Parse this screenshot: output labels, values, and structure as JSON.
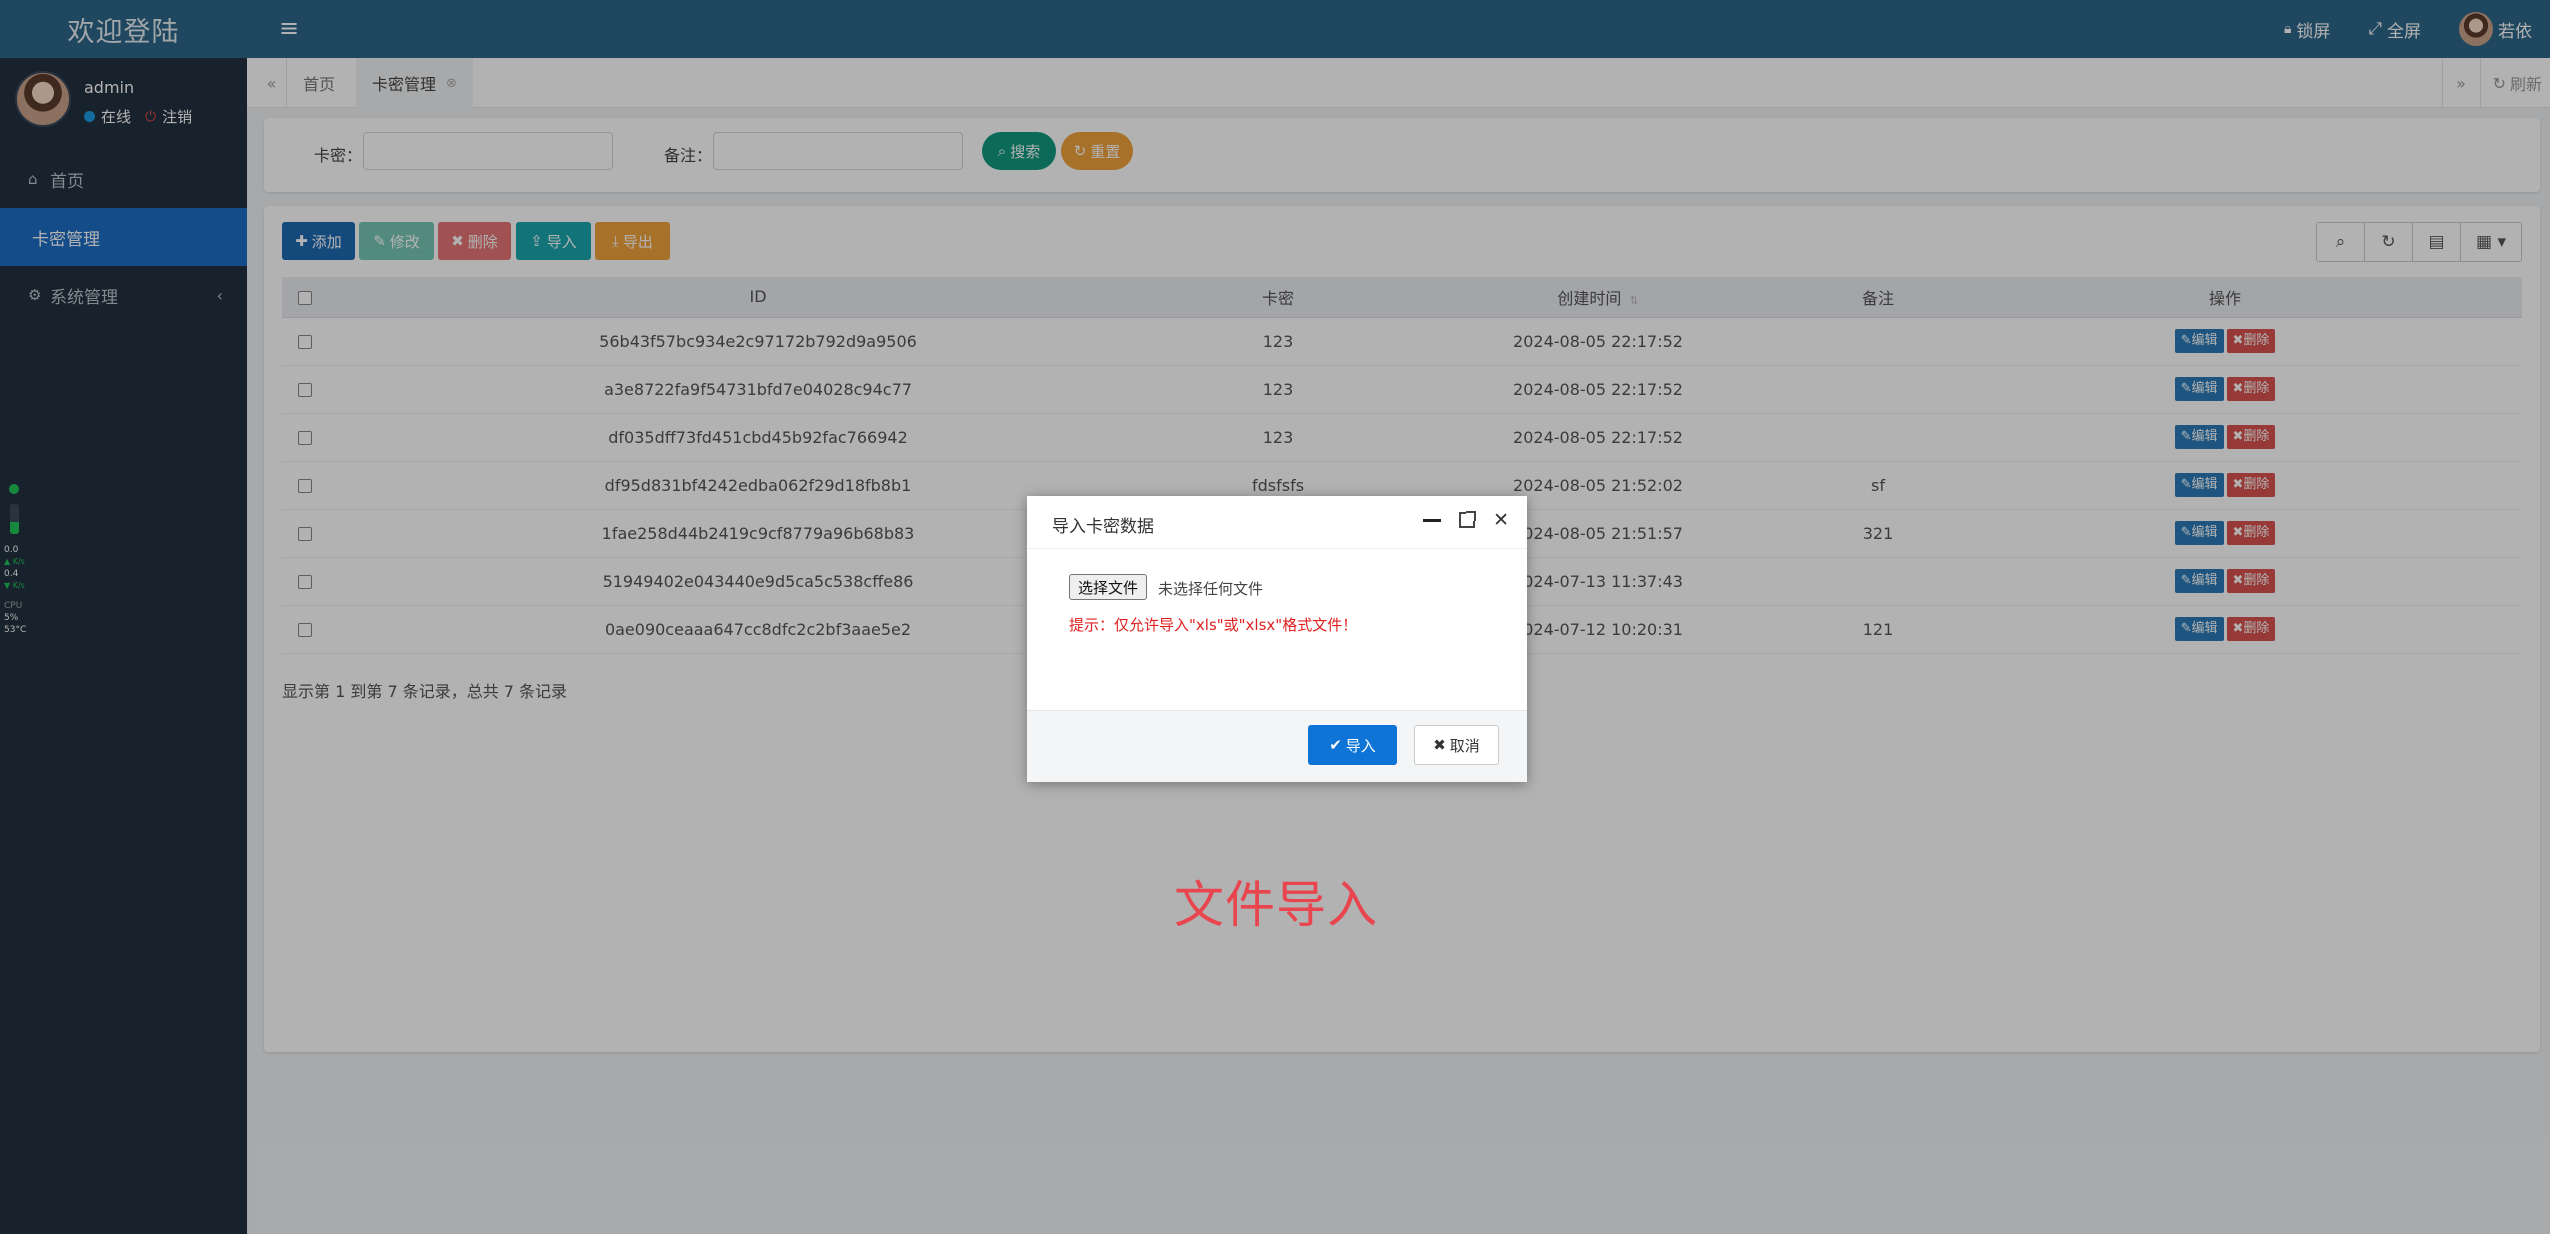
{
  "app": {
    "brand": "欢迎登陆",
    "user": {
      "name": "admin",
      "online": "在线",
      "logout": "注销"
    },
    "menu": [
      {
        "icon": "home-icon",
        "label": "首页"
      },
      {
        "icon": "",
        "label": "卡密管理"
      },
      {
        "icon": "gear-icon",
        "label": "系统管理"
      }
    ],
    "monitor": {
      "up": "0.0",
      "up_unit": "K/s",
      "down": "0.4",
      "down_unit": "K/s",
      "cpu_label": "CPU",
      "cpu": "5",
      "cpu_unit": "%",
      "temp": "53",
      "temp_unit": "°C"
    }
  },
  "topbar": {
    "lock": "锁屏",
    "fullscreen": "全屏",
    "username": "若依"
  },
  "tabs": {
    "home": "首页",
    "current": "卡密管理",
    "refresh": "刷新"
  },
  "search": {
    "card_label": "卡密：",
    "remark_label": "备注：",
    "search_btn": "搜索",
    "reset_btn": "重置"
  },
  "toolbar": {
    "add": "添加",
    "edit": "修改",
    "delete": "删除",
    "import": "导入",
    "export": "导出"
  },
  "table": {
    "headers": {
      "id": "ID",
      "card": "卡密",
      "created": "创建时间",
      "remark": "备注",
      "ops": "操作"
    },
    "op_edit": "编辑",
    "op_delete": "删除",
    "rows": [
      {
        "id": "56b43f57bc934e2c97172b792d9a9506",
        "card": "123",
        "created": "2024-08-05 22:17:52",
        "remark": ""
      },
      {
        "id": "a3e8722fa9f54731bfd7e04028c94c77",
        "card": "123",
        "created": "2024-08-05 22:17:52",
        "remark": ""
      },
      {
        "id": "df035dff73fd451cbd45b92fac766942",
        "card": "123",
        "created": "2024-08-05 22:17:52",
        "remark": ""
      },
      {
        "id": "df95d831bf4242edba062f29d18fb8b1",
        "card": "fdsfsfs",
        "created": "2024-08-05 21:52:02",
        "remark": "sf"
      },
      {
        "id": "1fae258d44b2419c9cf8779a96b68b83",
        "card": "",
        "created": "2024-08-05 21:51:57",
        "remark": "321"
      },
      {
        "id": "51949402e043440e9d5ca5c538cffe86",
        "card": "",
        "created": "2024-07-13 11:37:43",
        "remark": ""
      },
      {
        "id": "0ae090ceaaa647cc8dfc2c2bf3aae5e2",
        "card": "",
        "created": "2024-07-12 10:20:31",
        "remark": "121"
      }
    ],
    "pager_info": "显示第 1 到第 7 条记录，总共 7 条记录"
  },
  "modal": {
    "title": "导入卡密数据",
    "choose_file": "选择文件",
    "no_file": "未选择任何文件",
    "tip": "提示：仅允许导入\"xls\"或\"xlsx\"格式文件！",
    "ok": "导入",
    "cancel": "取消"
  },
  "watermark": "文件导入",
  "colors": {
    "sidebar_bg": "#233141",
    "topbar_bg": "#2d6688",
    "active_menu": "#1d6dc4",
    "btn_add": "#1e6bb0",
    "btn_edit": "#5fbfa8",
    "btn_delete": "#e25c5c",
    "btn_import": "#1aa6ad",
    "btn_export": "#f0a23b",
    "btn_search": "#109a7e",
    "btn_reset": "#f0a23b",
    "watermark": "#e8454e"
  }
}
